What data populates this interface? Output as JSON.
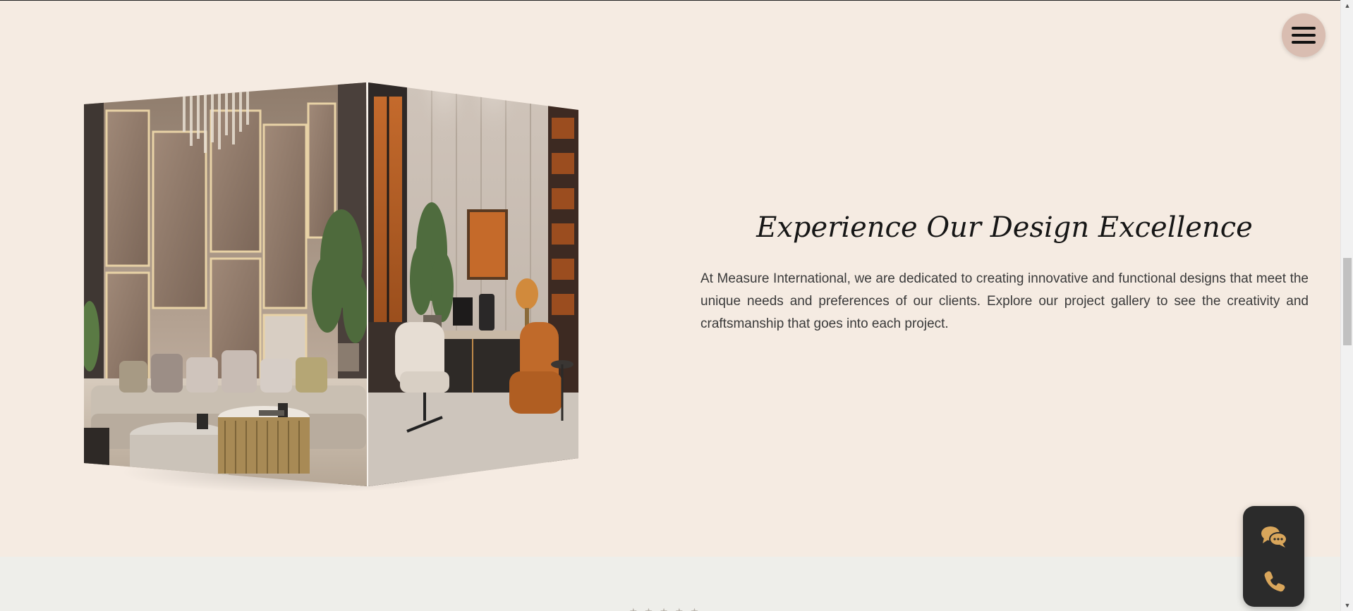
{
  "navigation": {
    "menu_icon": "hamburger-menu-icon"
  },
  "hero": {
    "heading": "Experience Our Design Excellence",
    "description": "At Measure International, we are dedicated to creating innovative and functional designs that meet the unique needs and preferences of our clients. Explore our project gallery to see the creativity and craftsmanship that goes into each project."
  },
  "gallery": {
    "faces": [
      {
        "icon": "living-room-image"
      },
      {
        "icon": "office-image"
      }
    ]
  },
  "next_section": {
    "rating_stars": "★★★★★"
  },
  "contact_widget": {
    "chat_icon": "chat-bubbles-icon",
    "phone_icon": "phone-icon"
  },
  "colors": {
    "background": "#f5ebe2",
    "menu_button": "#d9bdb1",
    "widget_background": "#2b2b2b",
    "widget_icon": "#d9a65b",
    "next_section_background": "#eeeeea"
  }
}
